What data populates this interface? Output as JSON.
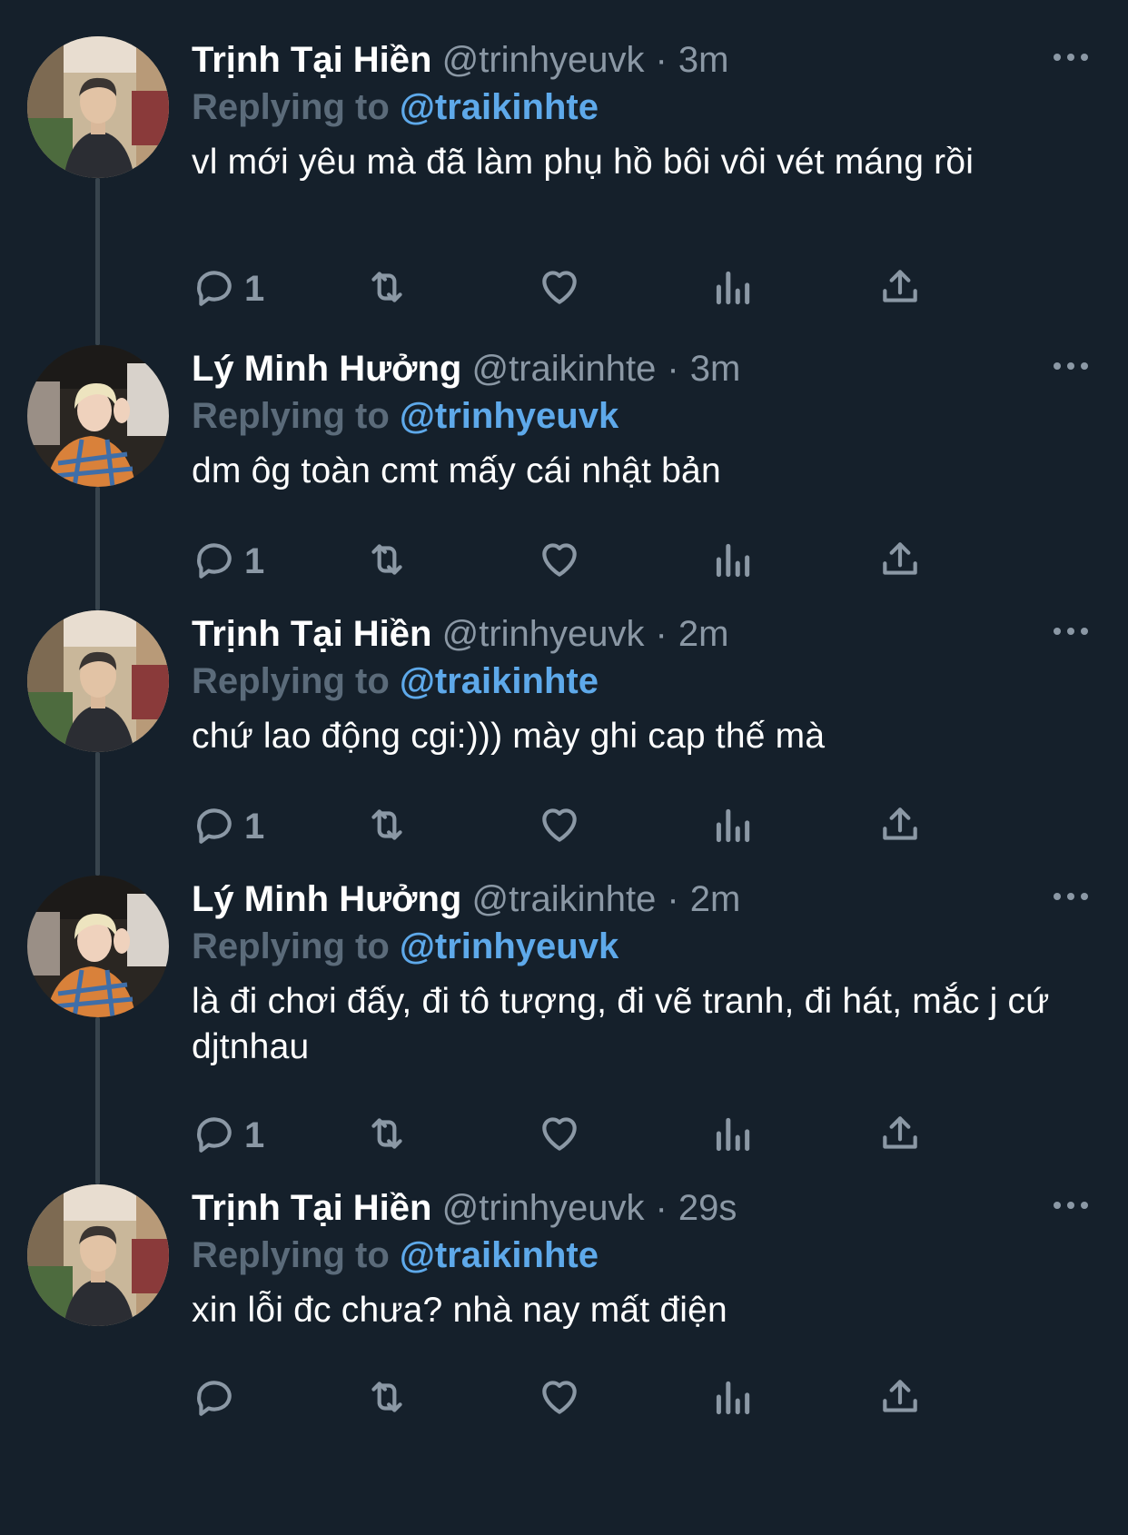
{
  "tweets": [
    {
      "name": "Trịnh Tại Hiền",
      "handle": "@trinhyeuvk",
      "separator": "·",
      "time": "3m",
      "replying_prefix": "Replying to",
      "replying_to": "@traikinhte",
      "text": "vl mới yêu mà đã làm phụ hồ bôi vôi vét máng rồi",
      "reply_count": "1",
      "avatar_style": "man-street"
    },
    {
      "name": "Lý Minh Hưởng",
      "handle": "@traikinhte",
      "separator": "·",
      "time": "3m",
      "replying_prefix": "Replying to",
      "replying_to": "@trinhyeuvk",
      "text": "dm ôg toàn cmt mấy cái nhật bản",
      "reply_count": "1",
      "avatar_style": "blond-car"
    },
    {
      "name": "Trịnh Tại Hiền",
      "handle": "@trinhyeuvk",
      "separator": "·",
      "time": "2m",
      "replying_prefix": "Replying to",
      "replying_to": "@traikinhte",
      "text": "chứ lao động cgi:))) mày ghi cap thế mà",
      "reply_count": "1",
      "avatar_style": "man-street"
    },
    {
      "name": "Lý Minh Hưởng",
      "handle": "@traikinhte",
      "separator": "·",
      "time": "2m",
      "replying_prefix": "Replying to",
      "replying_to": "@trinhyeuvk",
      "text": "là đi chơi đấy, đi tô tượng, đi vẽ tranh, đi hát, mắc j cứ djtnhau",
      "reply_count": "1",
      "avatar_style": "blond-car"
    },
    {
      "name": "Trịnh Tại Hiền",
      "handle": "@trinhyeuvk",
      "separator": "·",
      "time": "29s",
      "replying_prefix": "Replying to",
      "replying_to": "@traikinhte",
      "text": "xin lỗi đc chưa? nhà nay mất điện",
      "reply_count": "",
      "avatar_style": "man-street"
    }
  ],
  "icons": [
    "reply-icon",
    "retweet-icon",
    "like-icon",
    "analytics-icon",
    "share-icon",
    "more-icon"
  ],
  "colors": {
    "background": "#15202b",
    "name": "#ffffff",
    "secondary": "#8b98a5",
    "mention": "#5ea9ea",
    "thread_line": "#38444d"
  }
}
